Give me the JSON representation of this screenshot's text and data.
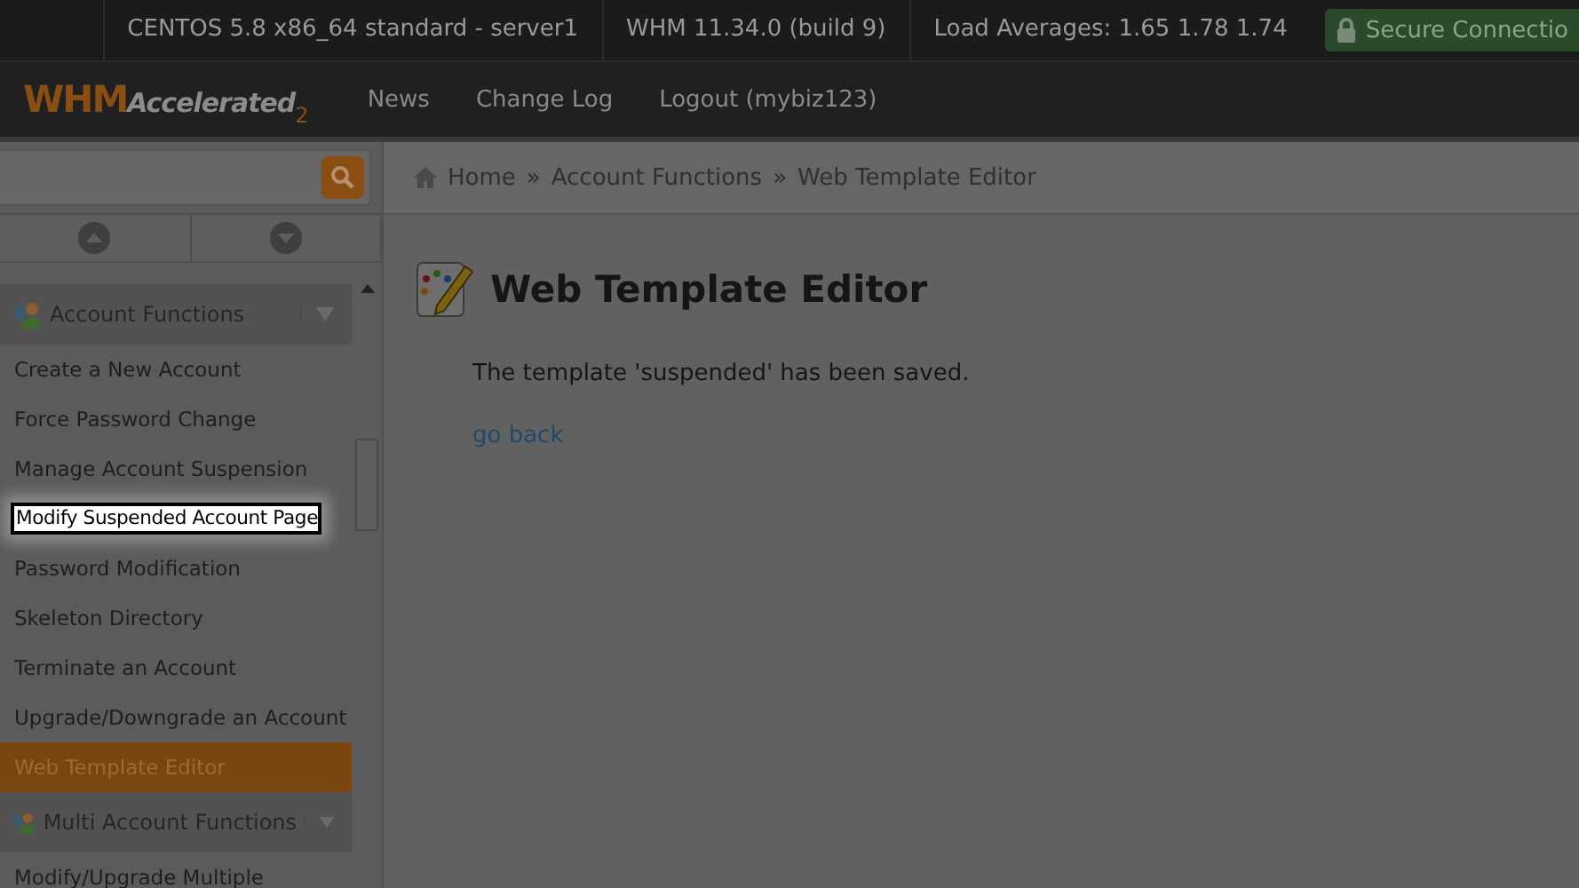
{
  "top_bar": {
    "items": [
      "CENTOS 5.8 x86_64 standard - server1",
      "WHM 11.34.0 (build 9)",
      "Load Averages: 1.65 1.78 1.74"
    ],
    "secure": "Secure Connectio"
  },
  "header": {
    "logo": {
      "main": "WHM",
      "script": "Accelerated",
      "version": "2"
    },
    "links": [
      "News",
      "Change Log",
      "Logout (mybiz123)"
    ]
  },
  "sidebar": {
    "groups": [
      {
        "label": "Account Functions",
        "items": [
          {
            "label": "Create a New Account",
            "selected": false,
            "highlighted": false
          },
          {
            "label": "Force Password Change",
            "selected": false,
            "highlighted": false
          },
          {
            "label": "Manage Account Suspension",
            "selected": false,
            "highlighted": false
          },
          {
            "label": "Modify Suspended Account Page",
            "selected": false,
            "highlighted": true
          },
          {
            "label": "Password Modification",
            "selected": false,
            "highlighted": false
          },
          {
            "label": "Skeleton Directory",
            "selected": false,
            "highlighted": false
          },
          {
            "label": "Terminate an Account",
            "selected": false,
            "highlighted": false
          },
          {
            "label": "Upgrade/Downgrade an Account",
            "selected": false,
            "highlighted": false
          },
          {
            "label": "Web Template Editor",
            "selected": true,
            "highlighted": false
          }
        ]
      },
      {
        "label": "Multi Account Functions",
        "items": [
          {
            "label": "Modify/Upgrade Multiple",
            "selected": false,
            "highlighted": false
          }
        ]
      }
    ]
  },
  "breadcrumb": {
    "separator": "»",
    "items": [
      "Home",
      "Account Functions",
      "Web Template Editor"
    ]
  },
  "page": {
    "title": "Web Template Editor",
    "message": "The template 'suspended' has been saved.",
    "link": "go back"
  }
}
